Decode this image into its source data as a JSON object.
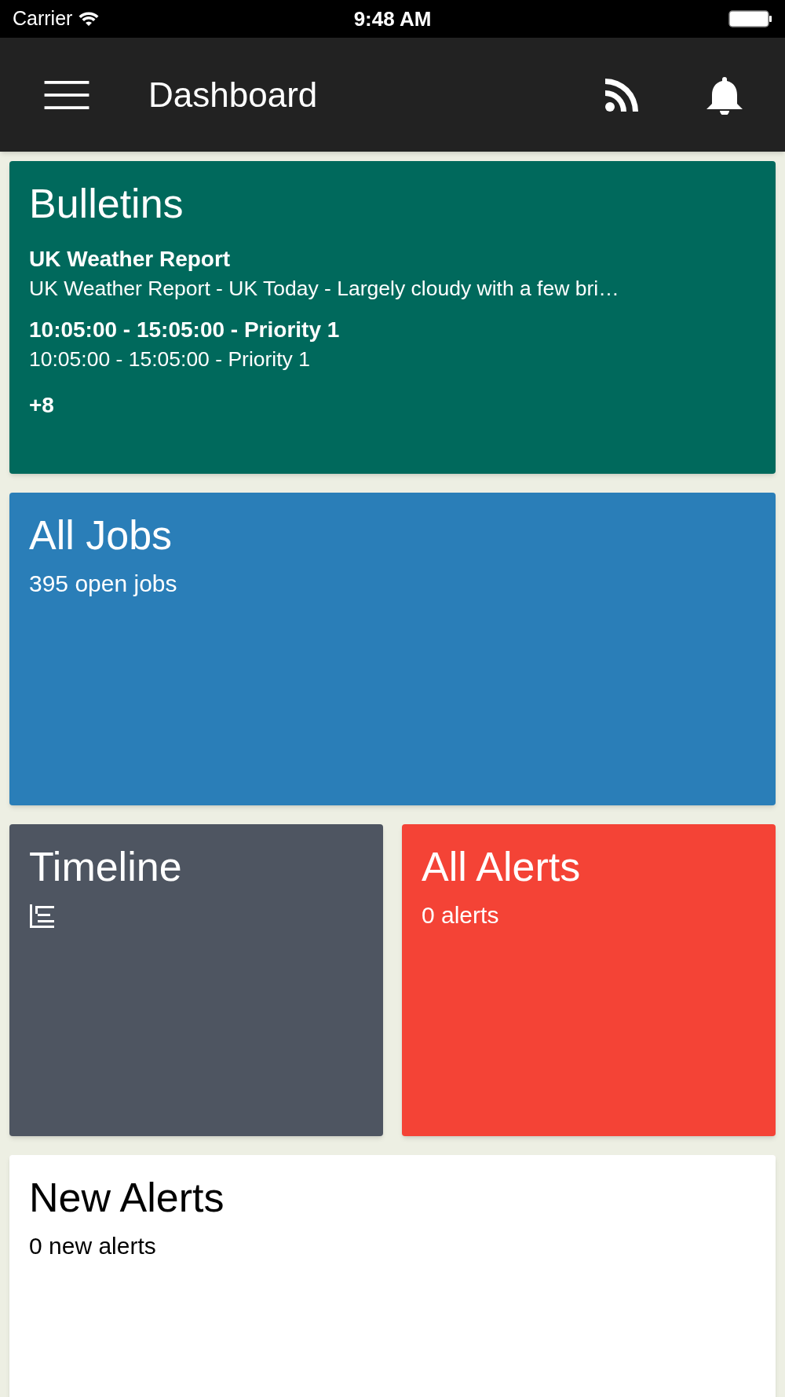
{
  "status_bar": {
    "carrier": "Carrier",
    "time": "9:48 AM"
  },
  "app_bar": {
    "title": "Dashboard"
  },
  "tile_rows": [
    [
      {
        "kind": "bulletins",
        "title": "Bulletins",
        "color": "#00695c",
        "bulletins": [
          {
            "heading": "UK Weather Report",
            "body": "UK Weather Report - UK Today - Largely cloudy with a few bri…"
          },
          {
            "heading": "10:05:00 - 15:05:00 - Priority 1",
            "body": "10:05:00 - 15:05:00 - Priority 1"
          }
        ],
        "more": "+8"
      }
    ],
    [
      {
        "kind": "stat",
        "title": "All Jobs",
        "color": "#2a7eb8",
        "subtitle": "395 open jobs"
      }
    ],
    [
      {
        "kind": "icon",
        "title": "Timeline",
        "color": "#4e5561"
      },
      {
        "kind": "stat",
        "title": "All Alerts",
        "color": "#f44336",
        "subtitle": "0 alerts"
      }
    ],
    [
      {
        "kind": "stat",
        "title": "New Alerts",
        "color": "#ffffff",
        "subtitle": "0 new alerts"
      }
    ]
  ]
}
